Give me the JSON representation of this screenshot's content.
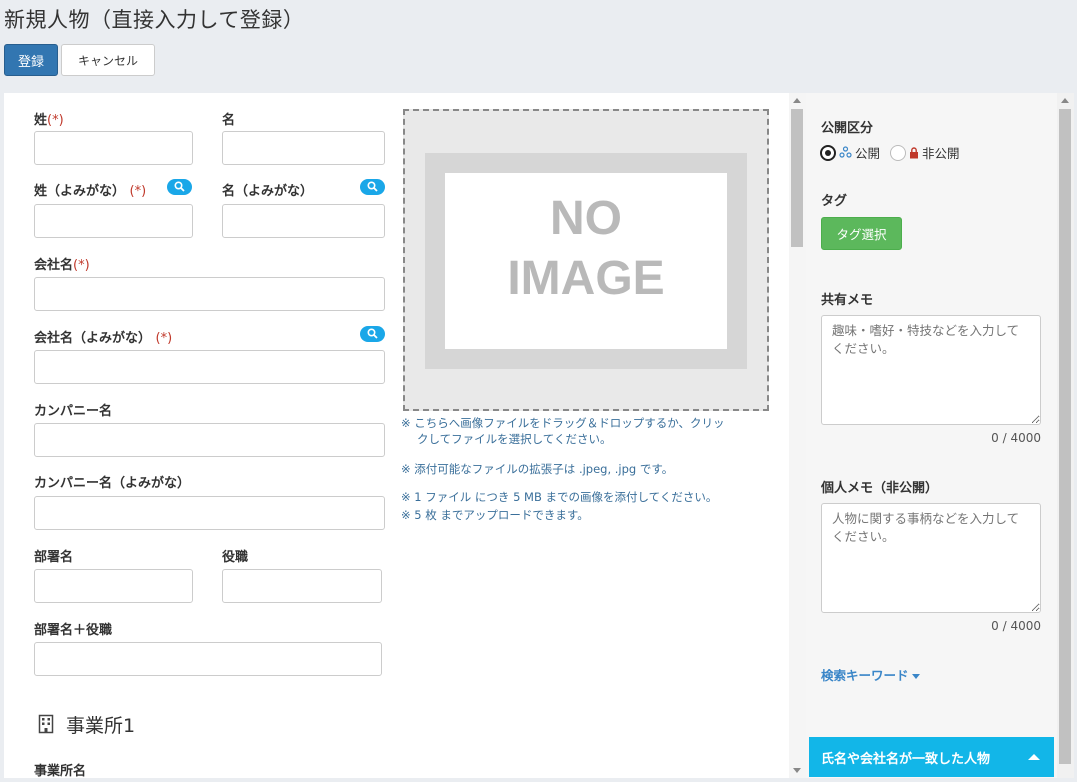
{
  "page": {
    "title": "新規人物（直接入力して登録）"
  },
  "toolbar": {
    "register_label": "登録",
    "cancel_label": "キャンセル"
  },
  "form": {
    "required_mark": "(*)",
    "last_name": "姓",
    "first_name": "名",
    "last_name_kana": "姓（よみがな）",
    "first_name_kana": "名（よみがな）",
    "company_name": "会社名",
    "company_name_kana": "会社名（よみがな）",
    "company_alias": "カンパニー名",
    "company_alias_kana": "カンパニー名（よみがな）",
    "department": "部署名",
    "position": "役職",
    "department_position": "部署名＋役職",
    "office_section": "事業所1",
    "office_name": "事業所名"
  },
  "image": {
    "placeholder_line1": "NO",
    "placeholder_line2": "IMAGE",
    "note1_line1": "※ こちらへ画像ファイルをドラッグ＆ドロップするか、クリッ",
    "note1_line2": "クしてファイルを選択してください。",
    "note2": "※ 添付可能なファイルの拡張子は .jpeg, .jpg です。",
    "note3": "※ 1 ファイル につき 5 MB までの画像を添付してください。",
    "note4": "※ 5 枚 までアップロードできます。"
  },
  "side": {
    "visibility_label": "公開区分",
    "public_label": "公開",
    "private_label": "非公開",
    "tag_label": "タグ",
    "tag_button": "タグ選択",
    "shared_memo_label": "共有メモ",
    "shared_memo_placeholder": "趣味・嗜好・特技などを入力してください。",
    "shared_memo_counter": "0 / 4000",
    "personal_memo_label": "個人メモ（非公開）",
    "personal_memo_placeholder": "人物に関する事柄などを入力してください。",
    "personal_memo_counter": "0 / 4000",
    "search_keyword_label": "検索キーワード"
  },
  "match_bar": {
    "label": "氏名や会社名が一致した人物"
  },
  "colors": {
    "primary": "#3276b1",
    "tag_green": "#5cb85c",
    "accent_cyan": "#12b6e8",
    "required_red": "#c0392b"
  }
}
